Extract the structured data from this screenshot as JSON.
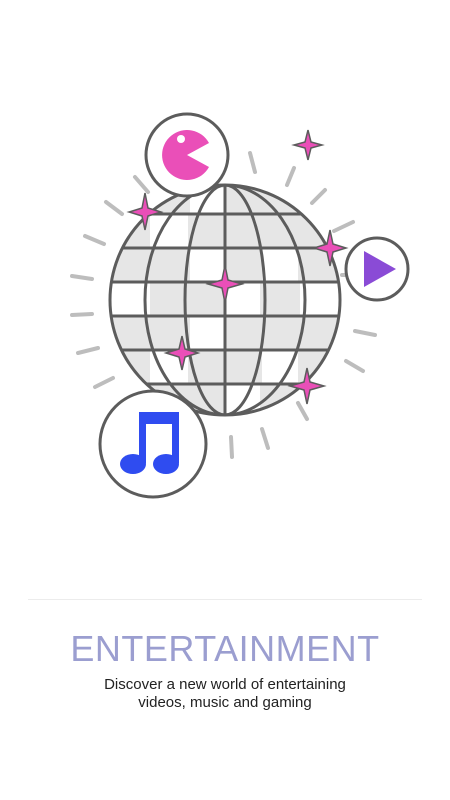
{
  "onboarding": {
    "title": "ENTERTAINMENT",
    "subtitle_line1": "Discover a new world of entertaining",
    "subtitle_line2": "videos, music and gaming"
  },
  "illustration": {
    "central_graphic": "disco-ball-icon",
    "satellite_icons": [
      "pacman-icon",
      "play-icon",
      "music-note-icon"
    ],
    "decorations": [
      "sparkle-icon",
      "ray-lines"
    ]
  },
  "colors": {
    "title": "#9b9ed0",
    "outline": "#5c5c5c",
    "ball_fill": "#e6e6e6",
    "sparkle": "#ea4fb8",
    "pacman": "#ea4fb8",
    "play": "#8a4bd6",
    "music": "#2f4cf0",
    "rays": "#bdbdbd"
  }
}
